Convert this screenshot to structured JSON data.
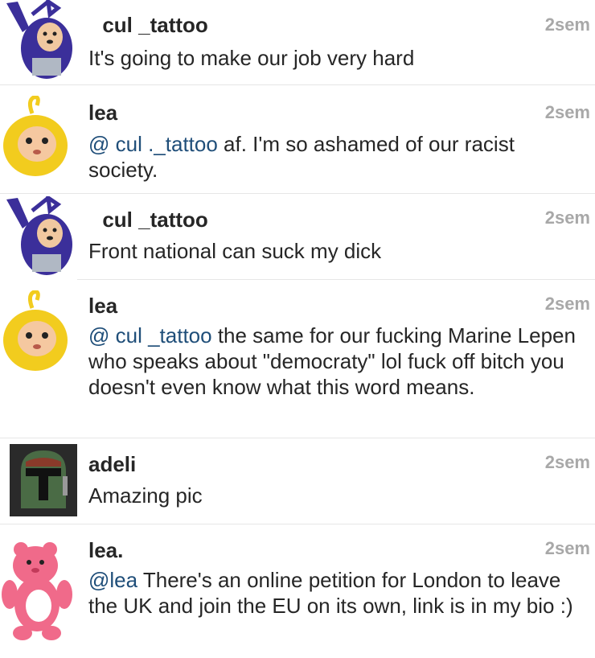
{
  "comments": [
    {
      "username": "cul _tattoo",
      "time": "2sem",
      "text": "It's going to make our job very hard",
      "avatar": "tinky-winky-icon",
      "avatar_color": "#3b2f9a"
    },
    {
      "username": "lea",
      "time": "2sem",
      "mention": "@ cul ._tattoo",
      "text": " af. I'm so ashamed of our racist society.",
      "avatar": "laa-laa-icon",
      "avatar_color": "#f2cc1e"
    },
    {
      "username": "cul _tattoo",
      "time": "2sem",
      "text": "Front national can suck my dick",
      "avatar": "tinky-winky-icon",
      "avatar_color": "#3b2f9a"
    },
    {
      "username": "lea",
      "time": "2sem",
      "mention": "@ cul _tattoo",
      "text": " the same for our fucking Marine Lepen who speaks about \"democraty\" lol fuck off bitch you doesn't even know what this word means.",
      "avatar": "laa-laa-icon",
      "avatar_color": "#f2cc1e"
    },
    {
      "username": "adeli",
      "time": "2sem",
      "text": "Amazing pic",
      "avatar": "helmet-icon",
      "avatar_color": "#3d5a3a"
    },
    {
      "username": "lea.",
      "time": "2sem",
      "mention": "@lea",
      "text": " There's an online petition for London to leave the UK and join the EU on its own, link is in my bio :)",
      "avatar": "care-bear-icon",
      "avatar_color": "#f06a8a"
    }
  ]
}
